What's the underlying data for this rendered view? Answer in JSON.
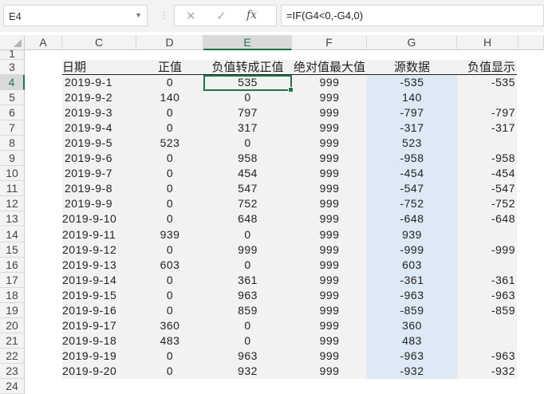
{
  "name_box": "E4",
  "formula": "=IF(G4<0,-G4,0)",
  "formula_icons": [
    "cancel-icon",
    "enter-icon",
    "function-icon"
  ],
  "columns": [
    "A",
    "C",
    "D",
    "E",
    "F",
    "G",
    "H"
  ],
  "selected_column": "E",
  "row_numbers": [
    "1",
    "3",
    "4",
    "5",
    "6",
    "7",
    "8",
    "9",
    "10",
    "11",
    "12",
    "13",
    "14",
    "15",
    "16",
    "17",
    "18",
    "19",
    "20",
    "21",
    "22",
    "23",
    "24"
  ],
  "headers": [
    "日期",
    "正值",
    "负值转成正值",
    "绝对值最大值",
    "源数据",
    "负值显示"
  ],
  "rows": [
    [
      "2019-9-1",
      "0",
      "535",
      "999",
      "-535",
      "-535"
    ],
    [
      "2019-9-2",
      "140",
      "0",
      "999",
      "140",
      ""
    ],
    [
      "2019-9-3",
      "0",
      "797",
      "999",
      "-797",
      "-797"
    ],
    [
      "2019-9-4",
      "0",
      "317",
      "999",
      "-317",
      "-317"
    ],
    [
      "2019-9-5",
      "523",
      "0",
      "999",
      "523",
      ""
    ],
    [
      "2019-9-6",
      "0",
      "958",
      "999",
      "-958",
      "-958"
    ],
    [
      "2019-9-7",
      "0",
      "454",
      "999",
      "-454",
      "-454"
    ],
    [
      "2019-9-8",
      "0",
      "547",
      "999",
      "-547",
      "-547"
    ],
    [
      "2019-9-9",
      "0",
      "752",
      "999",
      "-752",
      "-752"
    ],
    [
      "2019-9-10",
      "0",
      "648",
      "999",
      "-648",
      "-648"
    ],
    [
      "2019-9-11",
      "939",
      "0",
      "999",
      "939",
      ""
    ],
    [
      "2019-9-12",
      "0",
      "999",
      "999",
      "-999",
      "-999"
    ],
    [
      "2019-9-13",
      "603",
      "0",
      "999",
      "603",
      ""
    ],
    [
      "2019-9-14",
      "0",
      "361",
      "999",
      "-361",
      "-361"
    ],
    [
      "2019-9-15",
      "0",
      "963",
      "999",
      "-963",
      "-963"
    ],
    [
      "2019-9-16",
      "0",
      "859",
      "999",
      "-859",
      "-859"
    ],
    [
      "2019-9-17",
      "360",
      "0",
      "999",
      "360",
      ""
    ],
    [
      "2019-9-18",
      "483",
      "0",
      "999",
      "483",
      ""
    ],
    [
      "2019-9-19",
      "0",
      "963",
      "999",
      "-963",
      "-963"
    ],
    [
      "2019-9-20",
      "0",
      "932",
      "999",
      "-932",
      "-932"
    ]
  ],
  "colors": {
    "accent": "#217346",
    "source_fill": "#dde9f5",
    "table_fill": "#f2f2f2"
  }
}
